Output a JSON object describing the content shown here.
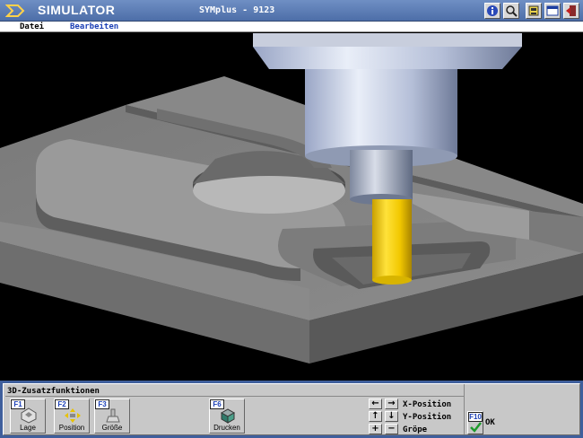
{
  "titlebar": {
    "app_title": "SIMULATOR",
    "document_title": "SYMplus - 9123",
    "buttons": [
      "info-icon",
      "zoom-icon",
      "tool-icon",
      "window-icon",
      "exit-icon"
    ]
  },
  "menu": {
    "items": [
      "Datei",
      "Bearbeiten"
    ]
  },
  "panel": {
    "title": "3D-Zusatzfunktionen",
    "fkeys": [
      {
        "key": "F1",
        "label": "Lage",
        "icon": "orientation-icon"
      },
      {
        "key": "F2",
        "label": "Position",
        "icon": "position-icon"
      },
      {
        "key": "F3",
        "label": "Größe",
        "icon": "size-icon"
      },
      {
        "key": "F6",
        "label": "Drucken",
        "icon": "print-icon"
      }
    ],
    "x_position": "X-Position",
    "y_position": "Y-Position",
    "groesse": "Gröpe",
    "ok_key": "F10",
    "ok_label": "OK",
    "colors": {
      "panel_border": "#3f5f9c",
      "panel_bg": "#c8c8c8",
      "key_text": "#1a3fb5"
    }
  }
}
